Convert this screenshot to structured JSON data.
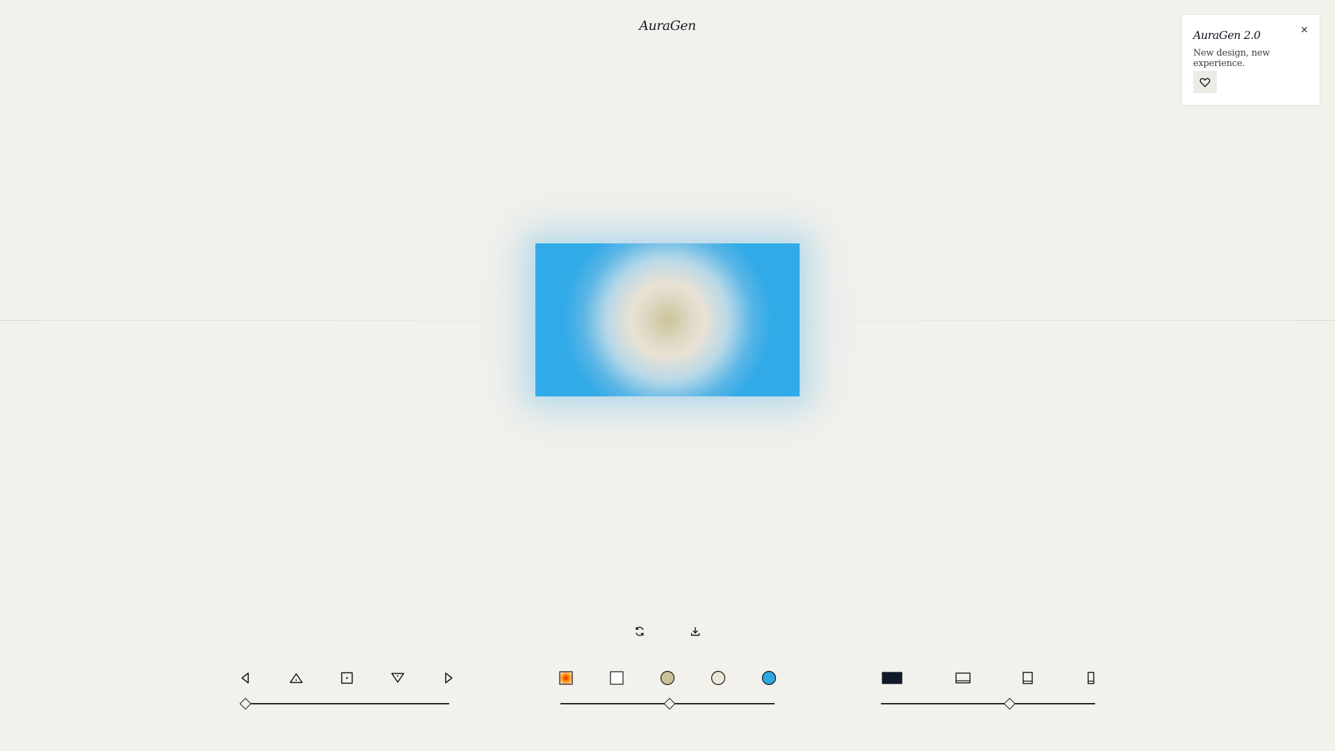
{
  "app": {
    "brand": "AuraGen"
  },
  "popup": {
    "title": "AuraGen 2.0",
    "text": "New design, new experience.",
    "close_label": "×",
    "close_icon": "close-icon",
    "like_icon": "heart-icon"
  },
  "preview": {
    "colors": [
      "#cbc397",
      "#e9e2d4",
      "#31aae8"
    ]
  },
  "actions": [
    {
      "name": "regenerate-button",
      "icon": "refresh-icon"
    },
    {
      "name": "download-button",
      "icon": "download-icon"
    }
  ],
  "controls": {
    "direction": {
      "options": [
        "arrow-left-icon",
        "triangle-up-icon",
        "center-square-icon",
        "triangle-down-icon",
        "arrow-right-icon"
      ],
      "slider_value": 0.0
    },
    "palette": {
      "options": [
        "gradient-swatch-icon",
        "white-swatch-icon",
        "khaki-swatch-icon",
        "beige-swatch-icon",
        "blue-swatch-icon"
      ],
      "colors": [
        "#ff7a00",
        "#ffffff",
        "#cbc397",
        "#e9e2d4",
        "#2fa6e0"
      ],
      "slider_value": 0.51
    },
    "aspect": {
      "options": [
        "landscape-wide-icon",
        "landscape-icon",
        "portrait-icon",
        "portrait-tall-icon"
      ],
      "slider_value": 0.6
    }
  }
}
